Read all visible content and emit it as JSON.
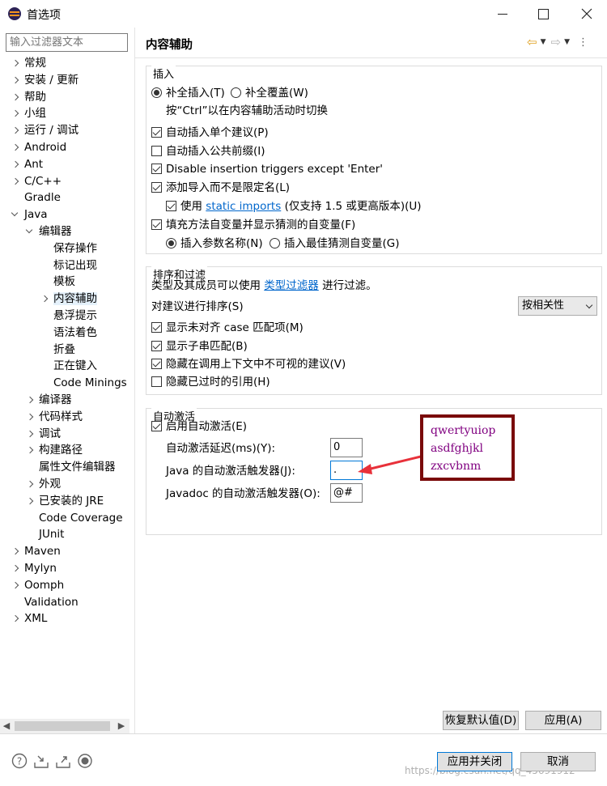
{
  "window": {
    "title": "首选项"
  },
  "filter": {
    "placeholder": "输入过滤器文本"
  },
  "tree": [
    {
      "label": "常规",
      "level": 0,
      "state": "closed"
    },
    {
      "label": "安装 / 更新",
      "level": 0,
      "state": "closed"
    },
    {
      "label": "帮助",
      "level": 0,
      "state": "closed"
    },
    {
      "label": "小组",
      "level": 0,
      "state": "closed"
    },
    {
      "label": "运行 / 调试",
      "level": 0,
      "state": "closed"
    },
    {
      "label": "Android",
      "level": 0,
      "state": "closed"
    },
    {
      "label": "Ant",
      "level": 0,
      "state": "closed"
    },
    {
      "label": "C/C++",
      "level": 0,
      "state": "closed"
    },
    {
      "label": "Gradle",
      "level": 0,
      "state": "none"
    },
    {
      "label": "Java",
      "level": 0,
      "state": "open"
    },
    {
      "label": "编辑器",
      "level": 1,
      "state": "open"
    },
    {
      "label": "保存操作",
      "level": 2,
      "state": "none"
    },
    {
      "label": "标记出现",
      "level": 2,
      "state": "none"
    },
    {
      "label": "模板",
      "level": 2,
      "state": "none"
    },
    {
      "label": "内容辅助",
      "level": 2,
      "state": "closed",
      "selected": true
    },
    {
      "label": "悬浮提示",
      "level": 2,
      "state": "none"
    },
    {
      "label": "语法着色",
      "level": 2,
      "state": "none"
    },
    {
      "label": "折叠",
      "level": 2,
      "state": "none"
    },
    {
      "label": "正在键入",
      "level": 2,
      "state": "none"
    },
    {
      "label": "Code Minings",
      "level": 2,
      "state": "none"
    },
    {
      "label": "编译器",
      "level": 1,
      "state": "closed"
    },
    {
      "label": "代码样式",
      "level": 1,
      "state": "closed"
    },
    {
      "label": "调试",
      "level": 1,
      "state": "closed"
    },
    {
      "label": "构建路径",
      "level": 1,
      "state": "closed"
    },
    {
      "label": "属性文件编辑器",
      "level": 1,
      "state": "none"
    },
    {
      "label": "外观",
      "level": 1,
      "state": "closed"
    },
    {
      "label": "已安装的 JRE",
      "level": 1,
      "state": "closed"
    },
    {
      "label": "Code Coverage",
      "level": 1,
      "state": "none"
    },
    {
      "label": "JUnit",
      "level": 1,
      "state": "none"
    },
    {
      "label": "Maven",
      "level": 0,
      "state": "closed"
    },
    {
      "label": "Mylyn",
      "level": 0,
      "state": "closed"
    },
    {
      "label": "Oomph",
      "level": 0,
      "state": "closed"
    },
    {
      "label": "Validation",
      "level": 0,
      "state": "none"
    },
    {
      "label": "XML",
      "level": 0,
      "state": "closed"
    }
  ],
  "page": {
    "title": "内容辅助"
  },
  "insert": {
    "group_title": "插入",
    "radio_insert": "补全插入(T)",
    "radio_overwrite": "补全覆盖(W)",
    "hint": "按“Ctrl”以在内容辅助活动时切换",
    "cb1": "自动插入单个建议(P)",
    "cb2": "自动插入公共前缀(I)",
    "cb3": "Disable insertion triggers except 'Enter'",
    "cb4": "添加导入而不是限定名(L)",
    "cb5_prefix": "使用",
    "cb5_link": "static imports",
    "cb5_suffix": "(仅支持 1.5 或更高版本)(U)",
    "cb6": "填充方法自变量并显示猜测的自变量(F)",
    "radio_param": "插入参数名称(N)",
    "radio_guess": "插入最佳猜测自变量(G)"
  },
  "sort": {
    "group_title": "排序和过滤",
    "desc_prefix": "类型及其成员可以使用",
    "desc_link": "类型过滤器",
    "desc_suffix": "进行过滤。",
    "sort_label": "对建议进行排序(S)",
    "sort_value": "按相关性",
    "cb1": "显示未对齐 case 匹配项(M)",
    "cb2": "显示子串匹配(B)",
    "cb3": "隐藏在调用上下文中不可视的建议(V)",
    "cb4": "隐藏已过时的引用(H)"
  },
  "auto": {
    "group_title": "自动激活",
    "cb_enable": "启用自动激活(E)",
    "delay_label": "自动激活延迟(ms)(Y):",
    "delay_value": "0",
    "java_label": "Java 的自动激活触发器(J):",
    "java_value": ".",
    "javadoc_label": "Javadoc 的自动激活触发器(O):",
    "javadoc_value": "@#"
  },
  "note": {
    "line1": "qwertyuiop",
    "line2": "asdfghjkl",
    "line3": "zxcvbnm"
  },
  "buttons": {
    "restore": "恢复默认值(D)",
    "apply": "应用(A)",
    "apply_close": "应用并关闭",
    "cancel": "取消"
  },
  "watermark": "https://blog.csdn.net/qq_45691912",
  "colors": {
    "link": "#0066cc",
    "note_border": "#7a0a0a",
    "note_text": "#800080",
    "arrow": "#e8313a"
  }
}
